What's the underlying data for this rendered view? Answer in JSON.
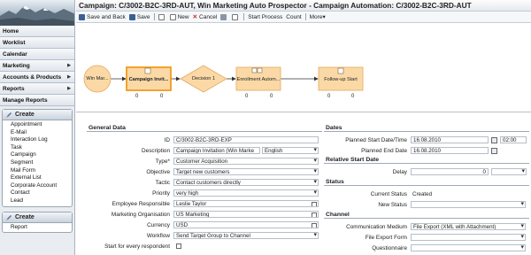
{
  "nav": {
    "items": [
      {
        "label": "Home",
        "arrow": false
      },
      {
        "label": "Worklist",
        "arrow": false
      },
      {
        "label": "Calendar",
        "arrow": false
      },
      {
        "label": "Marketing",
        "arrow": true
      },
      {
        "label": "Accounts & Products",
        "arrow": true
      },
      {
        "label": "Reports",
        "arrow": true
      },
      {
        "label": "Manage Reports",
        "arrow": false
      }
    ],
    "create1": {
      "title": "Create",
      "items": [
        "Appointment",
        "E-Mail",
        "Interaction Log",
        "Task",
        "Campaign",
        "Segment",
        "Mail Form",
        "External List",
        "Corporate Account",
        "Contact",
        "Lead"
      ]
    },
    "create2": {
      "title": "Create",
      "items": [
        "Report"
      ]
    }
  },
  "title": "Campaign: C/3002-B2C-3RD-AUT, Win Marketing Auto Prospector - Campaign Automation: C/3002-B2C-3RD-AUT",
  "toolbar": {
    "save_back": "Save and Back",
    "save": "Save",
    "new": "New",
    "cancel": "Cancel",
    "start_process": "Start Process",
    "count": "Count",
    "more": "More▾"
  },
  "flow": {
    "nodes": [
      {
        "label": "Win Mar...",
        "shape": "circle"
      },
      {
        "label": "Campaign Invit...",
        "shape": "box",
        "selected": true,
        "c1": "0",
        "c2": "0"
      },
      {
        "label": "Decision 1",
        "shape": "diamond"
      },
      {
        "label": "Enrollment Autom...",
        "shape": "box",
        "c1": "0",
        "c2": "0"
      },
      {
        "label": "Follow-up Start",
        "shape": "box",
        "c1": "0",
        "c2": "0"
      }
    ],
    "colors": {
      "fill": "#fbd9a6",
      "stroke": "#e3a85a",
      "selected": "#f29b1d"
    }
  },
  "general": {
    "heading": "General Data",
    "id_label": "ID",
    "id_value": "C/3002-B2C-3RD-EXP",
    "desc_label": "Description",
    "desc_value": "Campaign Invitation (Win Marke",
    "desc_lang": "English",
    "type_label": "Type*",
    "type_value": "Customer Acquisition",
    "objective_label": "Objective",
    "objective_value": "Target new customers",
    "tactic_label": "Tactic",
    "tactic_value": "Contact customers directly",
    "priority_label": "Priority",
    "priority_value": "very high",
    "employee_label": "Employee Responsible",
    "employee_value": "Leslie Taylor",
    "org_label": "Marketing Organisation",
    "org_value": "US Marketing",
    "currency_label": "Currency",
    "currency_value": "USD",
    "workflow_label": "Workflow",
    "workflow_value": "Send Target Group to Channel",
    "start_label": "Start for every respondent"
  },
  "dates": {
    "heading": "Dates",
    "start_label": "Planned Start Date/Time",
    "start_date": "16.08.2010",
    "start_time": "02:00",
    "end_label": "Planned End Date",
    "end_date": "16.08.2010",
    "relative_heading": "Relative Start Date",
    "delay_label": "Delay",
    "delay_value": "0"
  },
  "status": {
    "heading": "Status",
    "current_label": "Current Status",
    "current_value": "Created",
    "new_label": "New Status"
  },
  "channel": {
    "heading": "Channel",
    "medium_label": "Communication Medium",
    "medium_value": "File Export (XML with Attachment)",
    "form_label": "File Export Form",
    "questionnaire_label": "Questionnaire"
  }
}
